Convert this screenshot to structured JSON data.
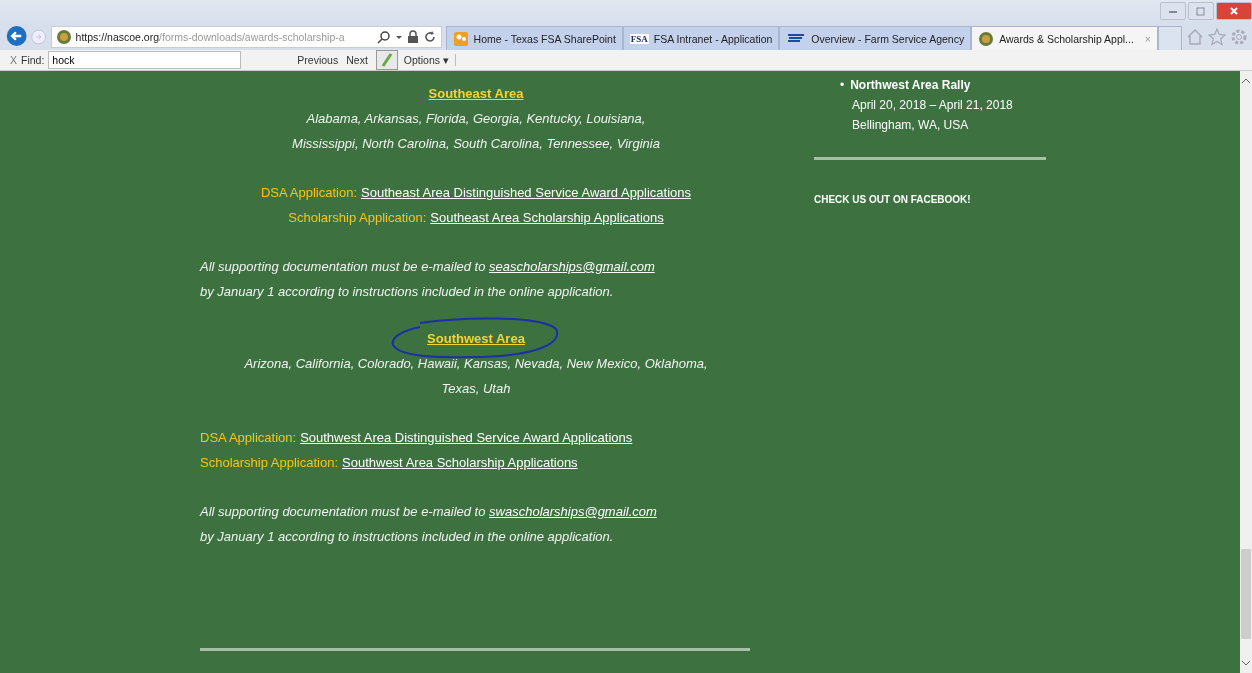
{
  "browser": {
    "address": {
      "host": "https://nascoe.org",
      "path": "/forms-downloads/awards-scholarship-a"
    },
    "tabs": [
      {
        "title": "Home - Texas FSA SharePoint",
        "selected": false,
        "kind": "sharepoint"
      },
      {
        "title": "FSA Intranet - Application",
        "selected": false,
        "kind": "fsa",
        "icon_text": "FSA"
      },
      {
        "title": "Overview - Farm Service Agency",
        "selected": false,
        "kind": "stripes"
      },
      {
        "title": "Awards & Scholarship Appl...",
        "selected": true,
        "kind": "seal",
        "close": "×"
      }
    ],
    "find_bar": {
      "close": "X",
      "label": "Find:",
      "value": "hock",
      "buttons": [
        "Previous",
        "Next"
      ],
      "options": "Options ▾"
    }
  },
  "main": {
    "sections": [
      {
        "heading": "Southeast Area",
        "circled": false,
        "states": [
          "Alabama, Arkansas, Florida, Georgia, Kentucky, Louisiana,",
          "Mississippi, North Carolina, South Carolina, Tennessee, Virginia"
        ],
        "kind": "centered",
        "links": [
          {
            "label": "DSA Application:",
            "link": "Southeast Area Distinguished Service Award Applications"
          },
          {
            "label": "Scholarship Application:",
            "link": "Southeast Area Scholarship Applications"
          }
        ],
        "note": {
          "before": "All supporting documentation must be e-mailed to",
          "email": "seascholarships@gmail.com",
          "after": "by January 1 according to instructions included in the online application."
        }
      },
      {
        "heading": "Southwest Area",
        "circled": true,
        "states": [
          "Arizona, California, Colorado, Hawaii, Kansas, Nevada, New Mexico, Oklahoma,",
          "Texas, Utah"
        ],
        "kind": "left",
        "links": [
          {
            "label": "DSA Application:",
            "link": "Southwest Area Distinguished Service Award Applications"
          },
          {
            "label": "Scholarship Application:",
            "link": "Southwest Area Scholarship Applications"
          }
        ],
        "note": {
          "before": "All supporting documentation must be e-mailed to",
          "email": "swascholarships@gmail.com",
          "after": "by January 1 according to instructions included in the online application."
        }
      }
    ]
  },
  "sidebar": {
    "event": {
      "bullet": "•",
      "title": "Northwest Area Rally",
      "dates": "April 20, 2018 – April 21, 2018",
      "location": "Bellingham, WA, USA"
    },
    "facebook": "CHECK US OUT ON FACEBOOK!"
  }
}
